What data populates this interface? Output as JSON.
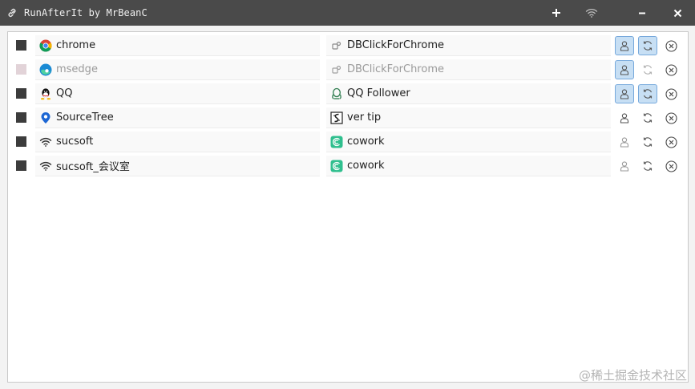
{
  "window": {
    "title": "RunAfterIt by MrBeanC",
    "title_icon": "link-icon",
    "buttons": [
      "add-icon",
      "wifi-icon",
      "minimize-icon",
      "close-icon"
    ]
  },
  "rules": [
    {
      "enabled": true,
      "name": "chrome",
      "name_icon": "chrome-icon",
      "process": "DBClickForChrome",
      "process_icon": "puzzle-icon",
      "run_as_user": true,
      "auto_restart": true,
      "disabled_style": false
    },
    {
      "enabled": false,
      "name": "msedge",
      "name_icon": "edge-icon",
      "process": "DBClickForChrome",
      "process_icon": "puzzle-icon",
      "run_as_user": true,
      "auto_restart": false,
      "disabled_style": true
    },
    {
      "enabled": true,
      "name": "QQ",
      "name_icon": "qq-penguin-icon",
      "process": "QQ Follower",
      "process_icon": "qq-outline-icon",
      "run_as_user": true,
      "auto_restart": true,
      "disabled_style": false
    },
    {
      "enabled": true,
      "name": "SourceTree",
      "name_icon": "sourcetree-icon",
      "process": "ver tip",
      "process_icon": "vertip-icon",
      "run_as_user": false,
      "auto_restart": false,
      "disabled_style": false
    },
    {
      "enabled": true,
      "name": "sucsoft",
      "name_icon": "wifi-icon",
      "process": "cowork",
      "process_icon": "cowork-icon",
      "run_as_user": false,
      "auto_restart": false,
      "disabled_style": false
    },
    {
      "enabled": true,
      "name": "sucsoft_会议室",
      "name_icon": "wifi-icon",
      "process": "cowork",
      "process_icon": "cowork-icon",
      "run_as_user": false,
      "auto_restart": false,
      "disabled_style": false
    }
  ],
  "colors": {
    "titlebar": "#4a4a4a",
    "toggle_on_bg": "#c7dff4",
    "toggle_on_border": "#77a9dc",
    "checkbox": "#3c3c3c"
  },
  "watermark": "@稀土掘金技术社区"
}
